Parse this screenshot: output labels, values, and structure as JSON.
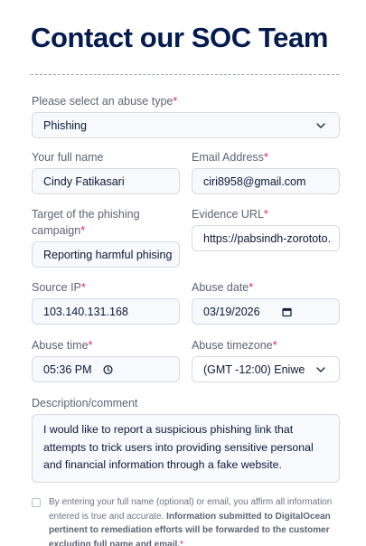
{
  "page": {
    "title": "Contact our SOC Team"
  },
  "form": {
    "abuse_type": {
      "label": "Please select an abuse type",
      "required_mark": "*",
      "value": "Phishing"
    },
    "full_name": {
      "label": "Your full name",
      "value": "Cindy Fatikasari"
    },
    "email": {
      "label": "Email Address",
      "required_mark": "*",
      "value": "ciri8958@gmail.com"
    },
    "target": {
      "label_line1": "Target of the phishing",
      "label_line2": "campaign",
      "required_mark": "*",
      "value": "Reporting harmful phising"
    },
    "evidence_url": {
      "label": "Evidence URL",
      "required_mark": "*",
      "value": "https://pabsindh-zorototo."
    },
    "source_ip": {
      "label": "Source IP",
      "required_mark": "*",
      "value": "103.140.131.168"
    },
    "abuse_date": {
      "label": "Abuse date",
      "required_mark": "*",
      "value": "03/19/2026"
    },
    "abuse_time": {
      "label": "Abuse time",
      "required_mark": "*",
      "value": "05:36 PM"
    },
    "abuse_timezone": {
      "label": "Abuse timezone",
      "required_mark": "*",
      "value": "(GMT -12:00) Eniwe"
    },
    "description": {
      "label": "Description/comment",
      "value": "I would like to report a suspicious phishing link that attempts to trick users into providing sensitive personal and financial information through a fake website."
    },
    "consent": {
      "text_plain": "By entering your full name (optional) or email, you affirm all information entered is true and accurate.",
      "text_bold": "Information submitted to DigitalOcean pertinent to remediation efforts will be forwarded to the customer excluding full name and email.",
      "required_mark": "*",
      "checked": false
    }
  },
  "icons": {
    "select_chevron": "chevron-down-icon",
    "date_picker": "calendar-icon",
    "time_picker": "clock-icon"
  },
  "colors": {
    "title": "#031b4e",
    "required": "#e0245e",
    "field_bg": "#f7f9fd",
    "field_border": "#d6dae3"
  }
}
